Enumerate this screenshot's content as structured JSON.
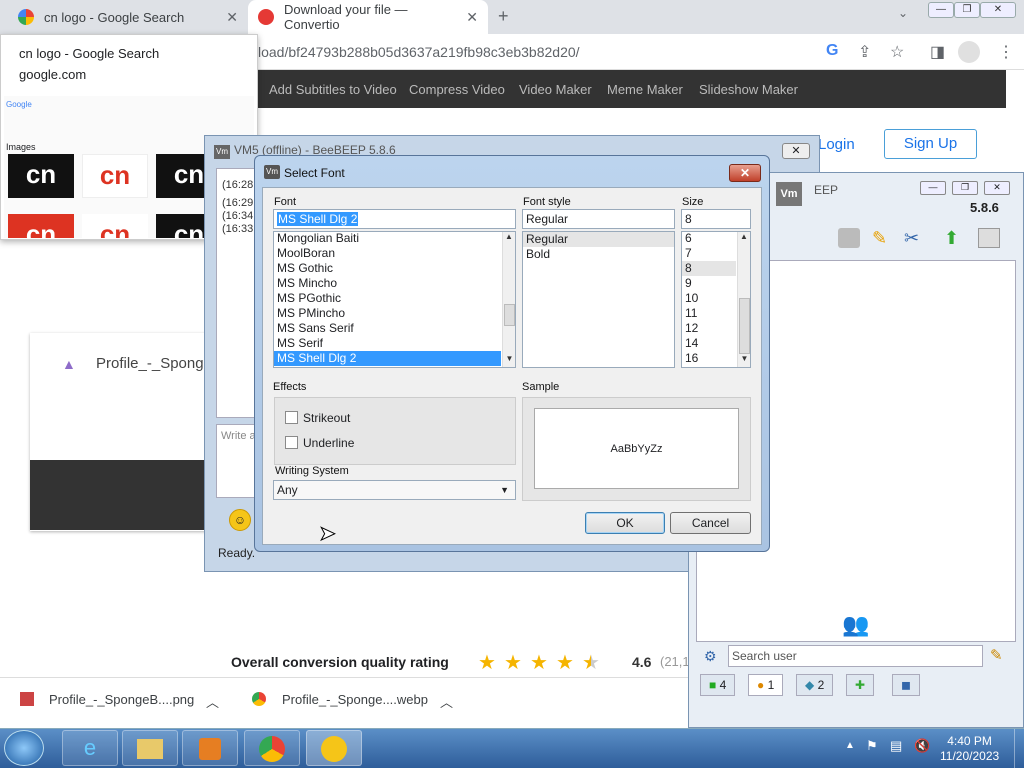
{
  "browser": {
    "tabs": [
      {
        "label": "cn logo - Google Search"
      },
      {
        "label": "Download your file — Convertio"
      }
    ],
    "url": "load/bf24793b288b05d3637a219fb98c3eb3b82d20/",
    "hovercard": {
      "title": "cn logo - Google Search",
      "domain": "google.com",
      "thumb_google": "Google",
      "thumb_images": "Images"
    }
  },
  "site": {
    "nav": [
      "Add Subtitles to Video",
      "Compress Video",
      "Video Maker",
      "Meme Maker",
      "Slideshow Maker"
    ],
    "login": "Login",
    "signup": "Sign Up",
    "profile_title": "Profile_-_Sponge",
    "rating_label": "Overall conversion quality rating",
    "rating_value": "4.6",
    "rating_count": "(21,1",
    "rating_stars": 4.5
  },
  "downloads": [
    {
      "name": "Profile_-_SpongeB....png"
    },
    {
      "name": "Profile_-_Sponge....webp"
    }
  ],
  "beebeep": {
    "main_title": "VM5 (offline) - BeeBEEP 5.8.6",
    "log_lines": [
      "(16:28",
      "(16:29",
      "(16:34",
      "(16:33"
    ],
    "write_placeholder": "Write a",
    "status": "Ready.",
    "side_title": "EEP",
    "side_logo": "Vm",
    "version": "5.8.6",
    "search_placeholder": "Search user",
    "bottom_tabs": [
      "4",
      "1",
      "2",
      "",
      ""
    ]
  },
  "dialog": {
    "title": "Select Font",
    "font_label": "Font",
    "font_value": "MS Shell Dlg 2",
    "font_list": [
      "Mongolian Baiti",
      "MoolBoran",
      "MS Gothic",
      "MS Mincho",
      "MS PGothic",
      "MS PMincho",
      "MS Sans Serif",
      "MS Serif",
      "MS Shell Dlg 2"
    ],
    "style_label": "Font style",
    "style_value": "Regular",
    "style_list": [
      "Regular",
      "Bold"
    ],
    "size_label": "Size",
    "size_value": "8",
    "size_list": [
      "6",
      "7",
      "8",
      "9",
      "10",
      "11",
      "12",
      "14",
      "16"
    ],
    "effects_label": "Effects",
    "strikeout": "Strikeout",
    "underline": "Underline",
    "writing_label": "Writing System",
    "writing_value": "Any",
    "sample_label": "Sample",
    "sample_text": "AaBbYyZz",
    "ok": "OK",
    "cancel": "Cancel"
  },
  "taskbar": {
    "time": "4:40 PM",
    "date": "11/20/2023"
  },
  "colors": {
    "accent": "#1a73e8",
    "selection": "#3399ff",
    "taskbar": "#2e5d9a"
  }
}
